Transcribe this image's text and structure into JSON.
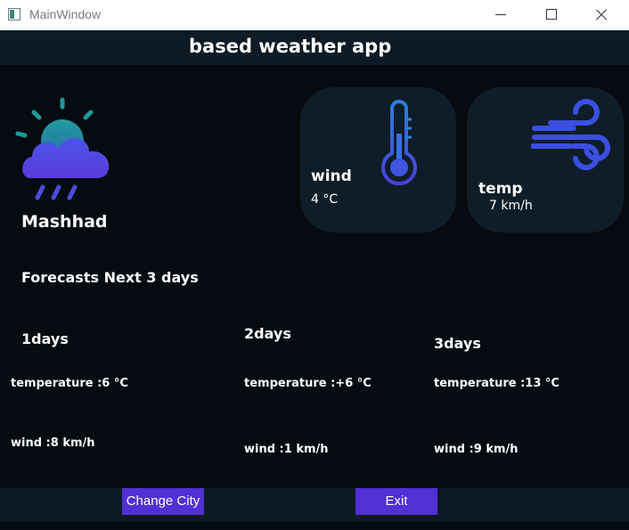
{
  "window": {
    "title": "MainWindow"
  },
  "header": {
    "title": "based weather app"
  },
  "current": {
    "city": "Mashhad"
  },
  "cards": {
    "wind": {
      "label": "wind",
      "value": "4 °C",
      "icon": "thermometer-icon"
    },
    "temp": {
      "label": "temp",
      "value": "7 km/h",
      "icon": "wind-icon"
    }
  },
  "forecast": {
    "title": "Forecasts Next 3 days",
    "days": [
      {
        "label": "1days",
        "temperature": "temperature :6 °C",
        "wind": "wind :8 km/h"
      },
      {
        "label": "2days",
        "temperature": "temperature :+6 °C",
        "wind": "wind :1 km/h"
      },
      {
        "label": "3days",
        "temperature": "temperature :13 °C",
        "wind": "wind :9 km/h"
      }
    ]
  },
  "buttons": {
    "change_city": "Change City",
    "exit": "Exit"
  },
  "colors": {
    "background": "#050b10",
    "panel": "#0e1a24",
    "card": "#0f1d28",
    "accent": "#5130d5",
    "icon_blue": "#3f51e0"
  }
}
